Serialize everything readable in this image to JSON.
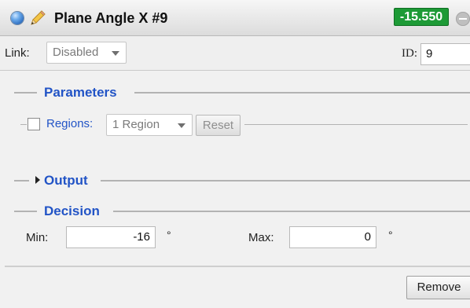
{
  "header": {
    "title": "Plane Angle X #9",
    "value": "-15.550",
    "value_color": "#1d9a36",
    "status_icon": "status-dot-blue",
    "edit_icon": "pencil-icon",
    "collapse_icon": "minus-circle-icon"
  },
  "link_row": {
    "link_label": "Link:",
    "link_value": "Disabled",
    "id_label": "ID:",
    "id_value": "9"
  },
  "parameters": {
    "heading": "Parameters",
    "regions_label": "Regions:",
    "regions_checked": false,
    "regions_value": "1 Region",
    "reset_label": "Reset"
  },
  "output": {
    "heading": "Output",
    "expanded": false
  },
  "decision": {
    "heading": "Decision",
    "min_label": "Min:",
    "min_value": "-16",
    "max_label": "Max:",
    "max_value": "0",
    "unit": "°"
  },
  "footer": {
    "remove_label": "Remove"
  },
  "colors": {
    "section_heading": "#2254c6",
    "panel_bg": "#f1f1f1"
  }
}
